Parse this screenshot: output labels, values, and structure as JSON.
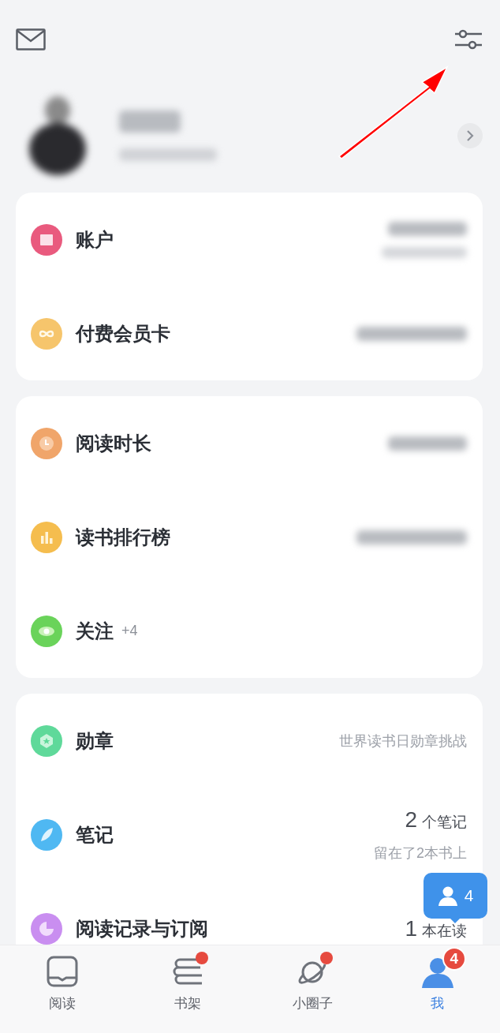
{
  "profile": {
    "redacted": true
  },
  "cards": [
    {
      "rows": [
        {
          "label": "账户",
          "color": "#e95a7e",
          "redacted": true,
          "redacted_sub": true
        },
        {
          "label": "付费会员卡",
          "color": "#f6c56c",
          "redacted": true
        }
      ]
    },
    {
      "rows": [
        {
          "label": "阅读时长",
          "color": "#f0a56a",
          "redacted": true
        },
        {
          "label": "读书排行榜",
          "color": "#f5bd4e",
          "redacted": true
        },
        {
          "label": "关注",
          "suffix": "+4",
          "color": "#6ad35a"
        }
      ]
    },
    {
      "rows": [
        {
          "label": "勋章",
          "color": "#5fd99a",
          "detail": "世界读书日勋章挑战"
        },
        {
          "label": "笔记",
          "color": "#4fb8f2",
          "count": "2",
          "unit": "个笔记",
          "sub": "留在了2本书上"
        },
        {
          "label": "阅读记录与订阅",
          "color": "#c98ef0",
          "count": "1",
          "unit": "本在读"
        }
      ]
    }
  ],
  "float_button": {
    "count": "4"
  },
  "nav": [
    {
      "label": "阅读",
      "selected": false,
      "dot": false
    },
    {
      "label": "书架",
      "selected": false,
      "dot": true
    },
    {
      "label": "小圈子",
      "selected": false,
      "dot": true
    },
    {
      "label": "我",
      "selected": true,
      "dot": false,
      "badge": "4"
    }
  ]
}
